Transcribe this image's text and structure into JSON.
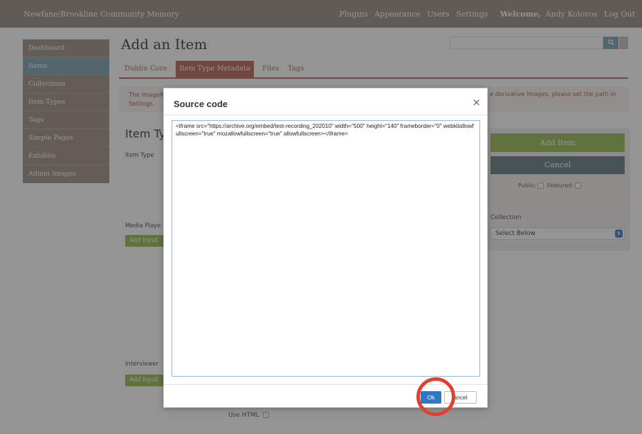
{
  "topbar": {
    "site_title": "Newfane/Brookline Community Memory",
    "nav": {
      "plugins": "Plugins",
      "appearance": "Appearance",
      "users": "Users",
      "settings": "Settings",
      "welcome_label": "Welcome,",
      "user_name": "Andy Kolovos",
      "logout": "Log Out"
    }
  },
  "sidebar": {
    "items": [
      {
        "label": "Dashboard"
      },
      {
        "label": "Items"
      },
      {
        "label": "Collections"
      },
      {
        "label": "Item Types"
      },
      {
        "label": "Tags"
      },
      {
        "label": "Simple Pages"
      },
      {
        "label": "Exhibits"
      },
      {
        "label": "Admin Images"
      }
    ]
  },
  "main": {
    "page_title": "Add an Item",
    "search": {
      "icon": "search-icon",
      "more": "..."
    },
    "tabs": [
      {
        "label": "Dublin Core"
      },
      {
        "label": "Item Type Metadata"
      },
      {
        "label": "Files"
      },
      {
        "label": "Tags"
      }
    ],
    "notice_left_1": "The ImageM",
    "notice_left_2": "Settings.",
    "notice_right": "e derivative images, please set the path in",
    "section_title": "Item Typ",
    "item_type_label": "Item Type",
    "media_player_label": "Media Playe",
    "add_input_1": "Add Input",
    "interviewer_label": "Interviewer",
    "add_input_2": "Add Input",
    "use_html_label": "Use HTML"
  },
  "panel": {
    "add_item": "Add Item",
    "cancel": "Cancel",
    "public_label": "Public:",
    "featured_label": "Featured:",
    "collection_label": "Collection",
    "collection_value": "Select Below"
  },
  "modal": {
    "title": "Source code",
    "close": "×",
    "code": "<iframe src=\"https://archive.org/embed/test-recording_202010\" width=\"500\" height=\"140\" frameborder=\"0\" webkitallowfullscreen=\"true\" mozallowfullscreen=\"true\" allowfullscreen></iframe>",
    "ok_label": "Ok",
    "cancel_label": "ancel"
  },
  "colors": {
    "accent": "#c1796c",
    "sidebar": "#ab9f97",
    "add_green": "#a6c56c",
    "ok_blue": "#2f79c4",
    "highlight_red": "#e2402f"
  }
}
